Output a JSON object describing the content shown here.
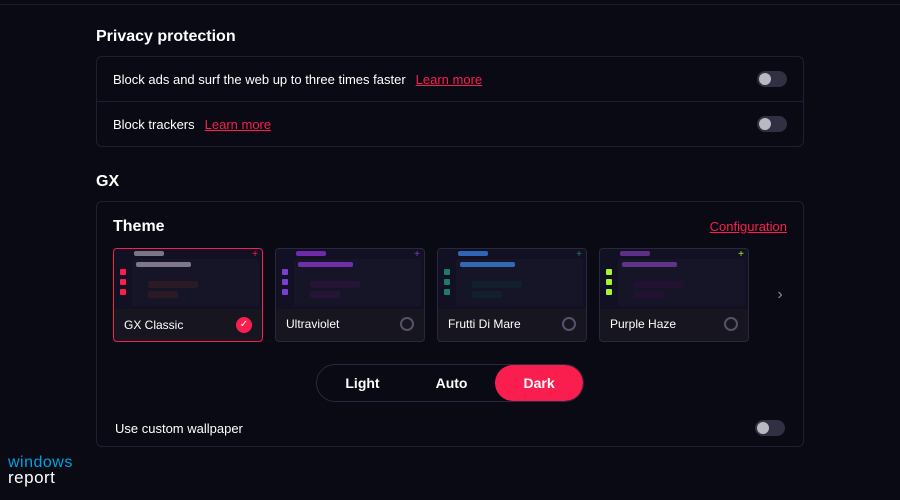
{
  "privacy": {
    "title": "Privacy protection",
    "rows": [
      {
        "label": "Block ads and surf the web up to three times faster",
        "link": "Learn more"
      },
      {
        "label": "Block trackers",
        "link": "Learn more"
      }
    ]
  },
  "gx": {
    "title": "GX",
    "theme_title": "Theme",
    "config_link": "Configuration",
    "themes": [
      {
        "name": "GX Classic",
        "selected": true
      },
      {
        "name": "Ultraviolet",
        "selected": false
      },
      {
        "name": "Frutti Di Mare",
        "selected": false
      },
      {
        "name": "Purple Haze",
        "selected": false
      }
    ],
    "modes": {
      "options": [
        "Light",
        "Auto",
        "Dark"
      ],
      "active": "Dark"
    },
    "wallpaper_label": "Use custom wallpaper"
  },
  "watermark": {
    "line1": "windows",
    "line2": "report"
  }
}
